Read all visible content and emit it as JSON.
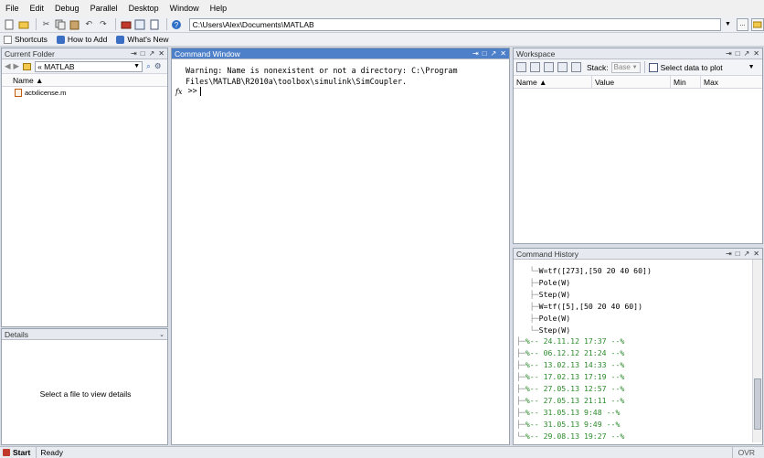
{
  "menu": [
    "File",
    "Edit",
    "Debug",
    "Parallel",
    "Desktop",
    "Window",
    "Help"
  ],
  "toolbar": {
    "current_path": "C:\\Users\\Alex\\Documents\\MATLAB",
    "browse_label": "...",
    "help_glyph": "?"
  },
  "shortcuts": {
    "shortcuts_label": "Shortcuts",
    "how_to_add_label": "How to Add",
    "whats_new_label": "What's New"
  },
  "current_folder": {
    "title": "Current Folder",
    "folder_name": "« MATLAB",
    "column_name": "Name ▲",
    "files": [
      "actxlicense.m"
    ]
  },
  "details": {
    "title": "Details",
    "message": "Select a file to view details"
  },
  "command_window": {
    "title": "Command Window",
    "output": "Warning: Name is nonexistent or not a directory: C:\\Program\nFiles\\MATLAB\\R2010a\\toolbox\\simulink\\SimCoupler.",
    "fx": "fx",
    "prompt": ">>"
  },
  "workspace": {
    "title": "Workspace",
    "stack_label": "Stack:",
    "stack_value": "Base",
    "select_data": "Select data to plot",
    "columns": [
      "Name ▲",
      "Value",
      "Min",
      "Max"
    ]
  },
  "history": {
    "title": "Command History",
    "commands": [
      "W=tf([273],[50 20 40 60])",
      "Pole(W)",
      "Step(W)",
      "W=tf([5],[50 20 40 60])",
      "Pole(W)",
      "Step(W)"
    ],
    "sessions": [
      "%-- 24.11.12 17:37 --%",
      "%-- 06.12.12 21:24 --%",
      "%-- 13.02.13 14:33 --%",
      "%-- 17.02.13 17:19 --%",
      "%-- 27.05.13 12:57 --%",
      "%-- 27.05.13 21:11 --%",
      "%-- 31.05.13 9:48 --%",
      "%-- 31.05.13 9:49 --%",
      "%-- 29.08.13 19:27 --%"
    ]
  },
  "status": {
    "start_label": "Start",
    "state": "Ready",
    "ovr": "OVR"
  },
  "colors": {
    "active_title": "#4d80c8",
    "history_date": "#2b8a2b",
    "desktop_bg": "#d8dde6"
  }
}
